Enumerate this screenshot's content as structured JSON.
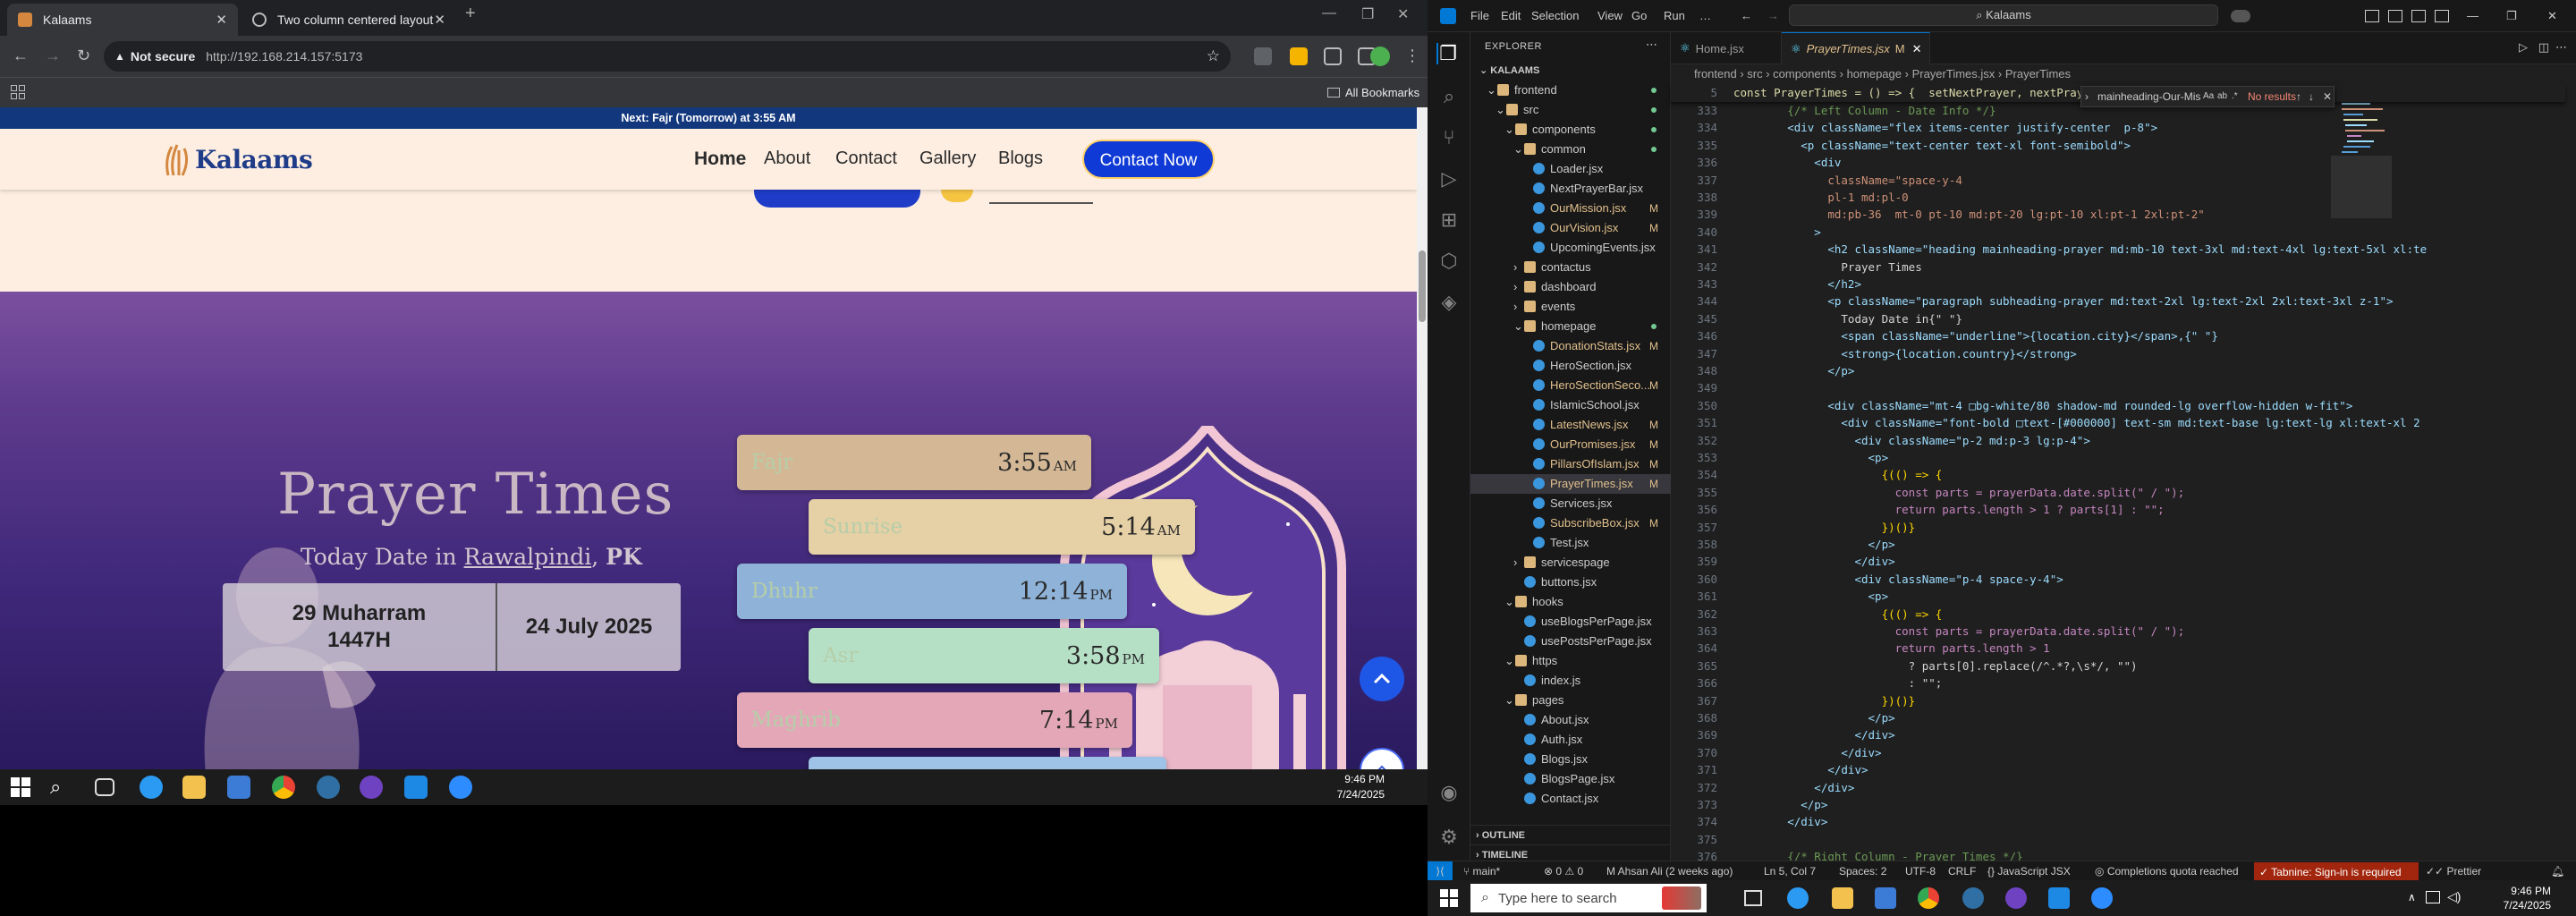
{
  "chrome": {
    "tabs": [
      {
        "label": "Kalaams",
        "active": true
      },
      {
        "label": "Two column centered layout",
        "active": false
      }
    ],
    "new_tab": "+",
    "security": "Not secure",
    "url": "http://192.168.214.157:5173",
    "all_bookmarks": "All Bookmarks"
  },
  "site": {
    "announcement": "Next: Fajr (Tomorrow) at 3:55 AM",
    "logo_text": "Kalaams",
    "nav": [
      "Home",
      "About",
      "Contact",
      "Gallery",
      "Blogs"
    ],
    "contact_button": "Contact Now",
    "prayer_title": "Prayer Times",
    "today_prefix": "Today Date in ",
    "city": "Rawalpindi",
    "country": "PK",
    "hijri_date": "29 Muharram 1447H",
    "gregorian_date": "24 July 2025",
    "prayers": [
      {
        "name": "Fajr",
        "time": "3:55",
        "ampm": "AM",
        "color": "#d4b896"
      },
      {
        "name": "Sunrise",
        "time": "5:14",
        "ampm": "AM",
        "color": "#e6d0a6"
      },
      {
        "name": "Dhuhr",
        "time": "12:14",
        "ampm": "PM",
        "color": "#8fb3d8"
      },
      {
        "name": "Asr",
        "time": "3:58",
        "ampm": "PM",
        "color": "#b6e0c6"
      },
      {
        "name": "Maghrib",
        "time": "7:14",
        "ampm": "PM",
        "color": "#e4a7b8"
      }
    ]
  },
  "left_taskbar": {
    "time": "9:46 PM",
    "date": "7/24/2025"
  },
  "vscode": {
    "menu": [
      "File",
      "Edit",
      "Selection",
      "View",
      "Go",
      "Run",
      "…"
    ],
    "search": "Kalaams",
    "explorer_title": "EXPLORER",
    "project": "KALAAMS",
    "tree": [
      {
        "label": "frontend",
        "type": "folder",
        "depth": 0,
        "open": true,
        "dot": true
      },
      {
        "label": "src",
        "type": "folder",
        "depth": 1,
        "open": true,
        "dot": true
      },
      {
        "label": "components",
        "type": "folder",
        "depth": 2,
        "open": true,
        "dot": true
      },
      {
        "label": "common",
        "type": "folder",
        "depth": 3,
        "open": true,
        "dot": true
      },
      {
        "label": "Loader.jsx",
        "type": "file",
        "depth": 4
      },
      {
        "label": "NextPrayerBar.jsx",
        "type": "file",
        "depth": 4
      },
      {
        "label": "OurMission.jsx",
        "type": "file",
        "depth": 4,
        "mod": "M"
      },
      {
        "label": "OurVision.jsx",
        "type": "file",
        "depth": 4,
        "mod": "M"
      },
      {
        "label": "UpcomingEvents.jsx",
        "type": "file",
        "depth": 4
      },
      {
        "label": "contactus",
        "type": "folder",
        "depth": 3
      },
      {
        "label": "dashboard",
        "type": "folder",
        "depth": 3
      },
      {
        "label": "events",
        "type": "folder",
        "depth": 3
      },
      {
        "label": "homepage",
        "type": "folder",
        "depth": 3,
        "open": true,
        "dot": true
      },
      {
        "label": "DonationStats.jsx",
        "type": "file",
        "depth": 4,
        "mod": "M"
      },
      {
        "label": "HeroSection.jsx",
        "type": "file",
        "depth": 4
      },
      {
        "label": "HeroSectionSeco...",
        "type": "file",
        "depth": 4,
        "mod": "M"
      },
      {
        "label": "IslamicSchool.jsx",
        "type": "file",
        "depth": 4
      },
      {
        "label": "LatestNews.jsx",
        "type": "file",
        "depth": 4,
        "mod": "M"
      },
      {
        "label": "OurPromises.jsx",
        "type": "file",
        "depth": 4,
        "mod": "M"
      },
      {
        "label": "PillarsOfIslam.jsx",
        "type": "file",
        "depth": 4,
        "mod": "M"
      },
      {
        "label": "PrayerTimes.jsx",
        "type": "file",
        "depth": 4,
        "mod": "M",
        "selected": true
      },
      {
        "label": "Services.jsx",
        "type": "file",
        "depth": 4
      },
      {
        "label": "SubscribeBox.jsx",
        "type": "file",
        "depth": 4,
        "mod": "M"
      },
      {
        "label": "Test.jsx",
        "type": "file",
        "depth": 4
      },
      {
        "label": "servicespage",
        "type": "folder",
        "depth": 3
      },
      {
        "label": "buttons.jsx",
        "type": "file",
        "depth": 3
      },
      {
        "label": "hooks",
        "type": "folder",
        "depth": 2,
        "open": true
      },
      {
        "label": "useBlogsPerPage.jsx",
        "type": "file",
        "depth": 3
      },
      {
        "label": "usePostsPerPage.jsx",
        "type": "file",
        "depth": 3
      },
      {
        "label": "https",
        "type": "folder",
        "depth": 2,
        "open": true
      },
      {
        "label": "index.js",
        "type": "file",
        "depth": 3
      },
      {
        "label": "pages",
        "type": "folder",
        "depth": 2,
        "open": true
      },
      {
        "label": "About.jsx",
        "type": "file",
        "depth": 3
      },
      {
        "label": "Auth.jsx",
        "type": "file",
        "depth": 3
      },
      {
        "label": "Blogs.jsx",
        "type": "file",
        "depth": 3
      },
      {
        "label": "BlogsPage.jsx",
        "type": "file",
        "depth": 3
      },
      {
        "label": "Contact.jsx",
        "type": "file",
        "depth": 3
      }
    ],
    "outline": "OUTLINE",
    "timeline": "TIMELINE",
    "editor_tabs": [
      {
        "label": "Home.jsx",
        "active": false
      },
      {
        "label": "PrayerTimes.jsx",
        "mod": "M",
        "active": true
      }
    ],
    "breadcrumb": [
      "frontend",
      "src",
      "components",
      "homepage",
      "PrayerTimes.jsx",
      "PrayerTimes"
    ],
    "sticky_line_no": "5",
    "sticky_line": "const PrayerTimes = () => {  setNextPrayer, nextPrayer",
    "find_query": "mainheading-Our-Mission",
    "find_result": "No results",
    "code_lines": [
      {
        "n": "333",
        "t": "        {/* Left Column - Date Info */}"
      },
      {
        "n": "334",
        "t": "        <div className=\"flex items-center justify-center  p-8\">"
      },
      {
        "n": "335",
        "t": "          <p className=\"text-center text-xl font-semibold\">"
      },
      {
        "n": "336",
        "t": "            <div"
      },
      {
        "n": "337",
        "t": "              className=\"space-y-4"
      },
      {
        "n": "338",
        "t": "              pl-1 md:pl-0"
      },
      {
        "n": "339",
        "t": "              md:pb-36  mt-0 pt-10 md:pt-20 lg:pt-10 xl:pt-1 2xl:pt-2\""
      },
      {
        "n": "340",
        "t": "            >"
      },
      {
        "n": "341",
        "t": "              <h2 className=\"heading mainheading-prayer md:mb-10 text-3xl md:text-4xl lg:text-5xl xl:te"
      },
      {
        "n": "342",
        "t": "                Prayer Times"
      },
      {
        "n": "343",
        "t": "              </h2>"
      },
      {
        "n": "344",
        "t": "              <p className=\"paragraph subheading-prayer md:text-2xl lg:text-2xl 2xl:text-3xl z-1\">"
      },
      {
        "n": "345",
        "t": "                Today Date in{\" \"}"
      },
      {
        "n": "346",
        "t": "                <span className=\"underline\">{location.city}</span>,{\" \"}"
      },
      {
        "n": "347",
        "t": "                <strong>{location.country}</strong>"
      },
      {
        "n": "348",
        "t": "              </p>"
      },
      {
        "n": "349",
        "t": ""
      },
      {
        "n": "350",
        "t": "              <div className=\"mt-4 □bg-white/80 shadow-md rounded-lg overflow-hidden w-fit\">"
      },
      {
        "n": "351",
        "t": "                <div className=\"font-bold □text-[#000000] text-sm md:text-base lg:text-lg xl:text-xl 2"
      },
      {
        "n": "352",
        "t": "                  <div className=\"p-2 md:p-3 lg:p-4\">"
      },
      {
        "n": "353",
        "t": "                    <p>"
      },
      {
        "n": "354",
        "t": "                      {(() => {"
      },
      {
        "n": "355",
        "t": "                        const parts = prayerData.date.split(\" / \");"
      },
      {
        "n": "356",
        "t": "                        return parts.length > 1 ? parts[1] : \"\";"
      },
      {
        "n": "357",
        "t": "                      })()}"
      },
      {
        "n": "358",
        "t": "                    </p>"
      },
      {
        "n": "359",
        "t": "                  </div>"
      },
      {
        "n": "360",
        "t": "                  <div className=\"p-4 space-y-4\">"
      },
      {
        "n": "361",
        "t": "                    <p>"
      },
      {
        "n": "362",
        "t": "                      {(() => {"
      },
      {
        "n": "363",
        "t": "                        const parts = prayerData.date.split(\" / \");"
      },
      {
        "n": "364",
        "t": "                        return parts.length > 1"
      },
      {
        "n": "365",
        "t": "                          ? parts[0].replace(/^.*?,\\s*/, \"\")"
      },
      {
        "n": "366",
        "t": "                          : \"\";"
      },
      {
        "n": "367",
        "t": "                      })()}"
      },
      {
        "n": "368",
        "t": "                    </p>"
      },
      {
        "n": "369",
        "t": "                  </div>"
      },
      {
        "n": "370",
        "t": "                </div>"
      },
      {
        "n": "371",
        "t": "              </div>"
      },
      {
        "n": "372",
        "t": "            </div>"
      },
      {
        "n": "373",
        "t": "          </p>"
      },
      {
        "n": "374",
        "t": "        </div>"
      },
      {
        "n": "375",
        "t": ""
      },
      {
        "n": "376",
        "t": "        {/* Right Column - Prayer Times */}"
      }
    ],
    "status": {
      "branch": "main*",
      "errors": "0",
      "warnings": "0",
      "blame": "M Ahsan Ali (2 weeks ago)",
      "position": "Ln 5, Col 7",
      "spaces": "Spaces: 2",
      "encoding": "UTF-8",
      "eol": "CRLF",
      "language": "JavaScript JSX",
      "copilot": "Completions quota reached",
      "tabnine": "Tabnine: Sign-in is required",
      "prettier": "Prettier"
    }
  },
  "right_taskbar": {
    "search_placeholder": "Type here to search",
    "time": "9:46 PM",
    "date": "7/24/2025"
  }
}
